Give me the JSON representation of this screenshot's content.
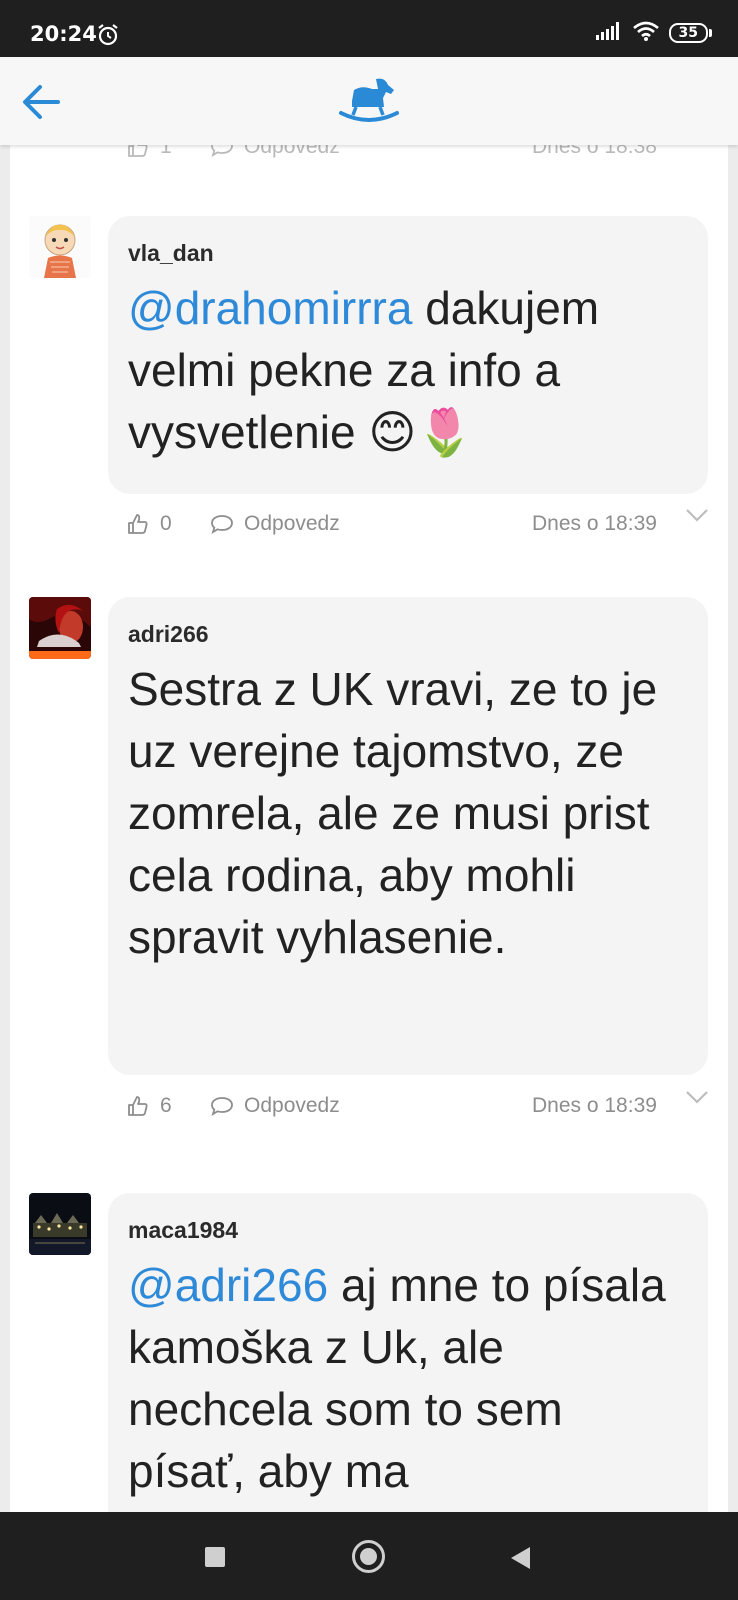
{
  "status_bar": {
    "time": "20:24",
    "battery": "35"
  },
  "previous_comment": {
    "likes": "1",
    "reply_label": "Odpovedz",
    "time": "Dnes o 18:38"
  },
  "comments": [
    {
      "username": "vla_dan",
      "mention": "@drahomirrra",
      "text": "dakujem velmi pekne za info a vysvetlenie 😊🌷",
      "likes": "0",
      "reply_label": "Odpovedz",
      "time": "Dnes o 18:39"
    },
    {
      "username": "adri266",
      "mention": "",
      "text": "Sestra z UK vravi, ze to je uz verejne tajomstvo, ze zomrela, ale ze musi prist cela rodina, aby mohli spravit vyhlasenie.",
      "likes": "6",
      "reply_label": "Odpovedz",
      "time": "Dnes o 18:39"
    },
    {
      "username": "maca1984",
      "mention": "@adri266",
      "text": "aj mne to písala kamoška z Uk, ale nechcela som to sem písať, aby ma",
      "likes": "",
      "reply_label": "",
      "time": ""
    }
  ],
  "colors": {
    "accent": "#2e8ad8",
    "bubble": "#f4f4f4",
    "meta": "#8d8d8d"
  },
  "icons": {
    "back": "arrow-left-icon",
    "logo": "rocking-horse-icon",
    "like": "thumbs-up-icon",
    "reply": "speech-bubble-icon",
    "expand": "chevron-down-icon"
  }
}
